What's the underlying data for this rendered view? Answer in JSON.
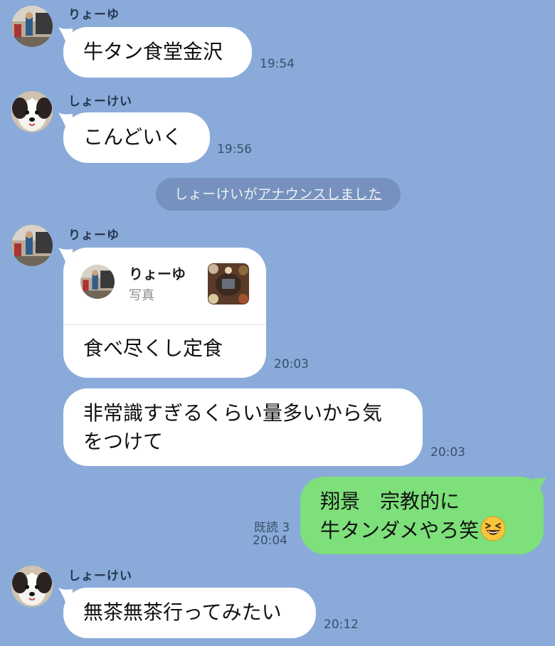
{
  "messages": {
    "m1": {
      "sender": "りょーゆ",
      "text": "牛タン食堂金沢",
      "time": "19:54"
    },
    "m2": {
      "sender": "しょーけい",
      "text": "こんどいく",
      "time": "19:56"
    },
    "notice": {
      "prefix": "しょーけいが",
      "link": "アナウンスしました"
    },
    "m3": {
      "sender": "りょーゆ",
      "quote_name": "りょーゆ",
      "quote_type": "写真",
      "text": "食べ尽くし定食",
      "time": "20:03"
    },
    "m4": {
      "line1": "非常識すぎるくらい量多いから気",
      "line2": "をつけて",
      "time": "20:03"
    },
    "m5": {
      "line1": "翔景　宗教的に",
      "line2": "牛タンダメやろ笑",
      "read": "既読 3",
      "time": "20:04",
      "emoji": "grinning-squinting-face-emoji"
    },
    "m6": {
      "sender": "しょーけい",
      "text": "無茶無茶行ってみたい",
      "time": "20:12"
    }
  },
  "icons": {
    "avatar_ryoyu": "room-photo-avatar",
    "avatar_shokei": "dog-photo-avatar",
    "quote_thumbnail": "food-photo-thumbnail"
  },
  "colors": {
    "background": "#8aabd9",
    "bubble_received": "#ffffff",
    "bubble_sent": "#7de07a",
    "notice": "#7691bd"
  }
}
